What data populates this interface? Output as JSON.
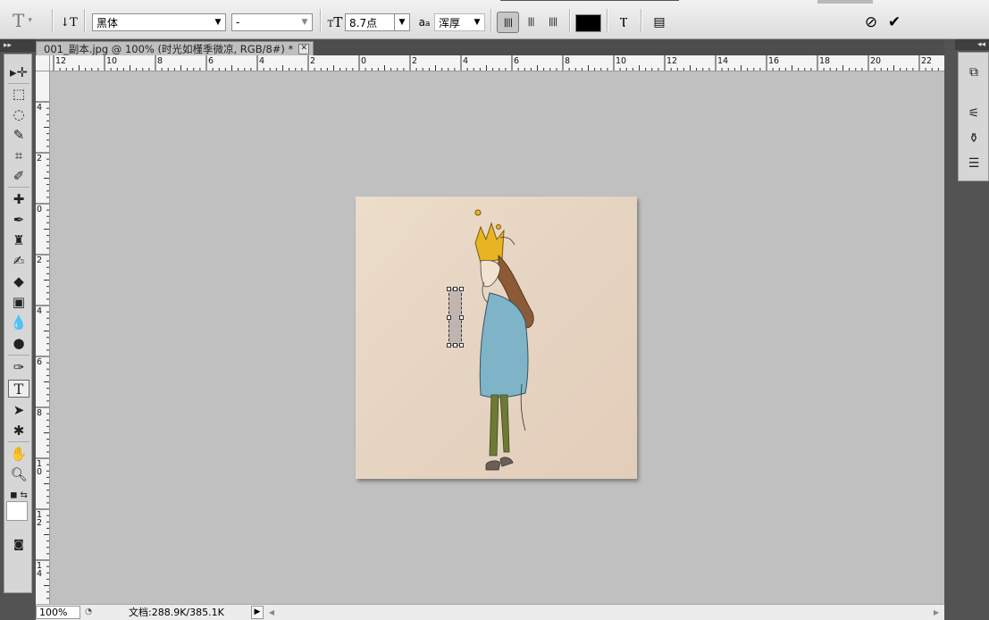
{
  "options_bar": {
    "tool_icon": "type-tool-icon",
    "orientation_icon": "toggle-orientation-icon",
    "font_family": "黑体",
    "font_style": "-",
    "font_size": "8.7点",
    "anti_alias": "浑厚",
    "text_color": "#000000",
    "cancel_icon": "cancel-icon",
    "commit_icon": "commit-checkmark-icon"
  },
  "document": {
    "tab_title": "001_副本.jpg @ 100% (时光如槿季微凉, RGB/8#) *",
    "close_glyph": "✕"
  },
  "ruler": {
    "horizontal_labels": [
      "12",
      "10",
      "8",
      "6",
      "4",
      "2",
      "0",
      "2",
      "4",
      "6",
      "8",
      "10",
      "12",
      "14",
      "16",
      "18",
      "20",
      "22"
    ],
    "vertical_labels": [
      "4",
      "2",
      "0",
      "2",
      "4",
      "6",
      "8",
      "10",
      "12",
      "14"
    ]
  },
  "status": {
    "zoom": "100%",
    "doc_info": "文档:288.9K/385.1K"
  },
  "colors": {
    "foreground": "#ffffff",
    "background": "#ffffff",
    "canvas_bg": "#c0c0c0"
  }
}
